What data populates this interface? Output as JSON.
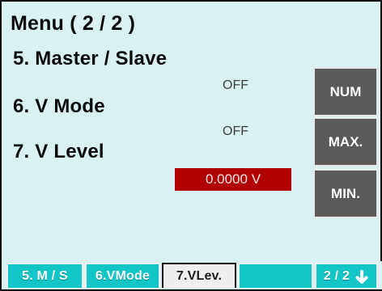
{
  "menu": {
    "title": "Menu ( 2 / 2 )",
    "items": [
      "5. Master / Slave",
      "6. V Mode",
      "7. V Level"
    ],
    "values": {
      "master_slave": "OFF",
      "v_mode": "OFF",
      "v_level": "0.0000 V"
    }
  },
  "side_buttons": [
    "NUM",
    "MAX.",
    "MIN."
  ],
  "tabs": [
    "5. M / S",
    "6.VMode",
    "7.VLev.",
    "",
    "2 / 2"
  ],
  "icons": {
    "page_down": "arrow-down-icon"
  },
  "colors": {
    "screen_bg": "#d9f1f1",
    "tab_active_bg": "#efefef",
    "tab_bg": "#12c6c8",
    "level_bg": "#b00000",
    "button_bg": "#5a5a5a"
  }
}
